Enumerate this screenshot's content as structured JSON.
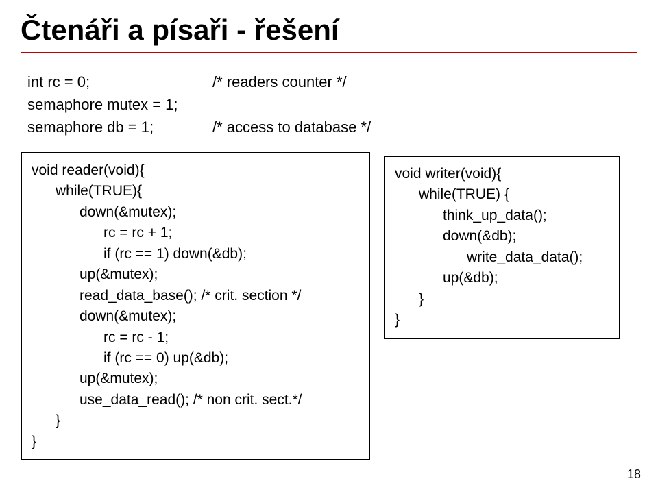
{
  "title": "Čtenáři a písaři - řešení",
  "decl": {
    "rc": "int rc = 0;",
    "rc_comment": "/* readers counter */",
    "mutex": "semaphore mutex = 1;",
    "db": "semaphore db = 1;",
    "db_comment": "/* access to database */"
  },
  "reader": {
    "l1": "void reader(void){",
    "l2": "while(TRUE){",
    "l3": "down(&mutex);",
    "l4": "rc = rc + 1;",
    "l5": "if (rc == 1) down(&db);",
    "l6": "up(&mutex);",
    "l7": "read_data_base(); /* crit. section */",
    "l8": "down(&mutex);",
    "l9": "rc = rc - 1;",
    "l10": "if (rc == 0) up(&db);",
    "l11": "up(&mutex);",
    "l12": "use_data_read(); /* non crit. sect.*/",
    "l13": "}",
    "l14": "}"
  },
  "writer": {
    "l1": "void writer(void){",
    "l2": "while(TRUE) {",
    "l3": "think_up_data();",
    "l4": "down(&db);",
    "l5": "write_data_data();",
    "l6": "up(&db);",
    "l7": "}",
    "l8": "}"
  },
  "page_number": "18"
}
